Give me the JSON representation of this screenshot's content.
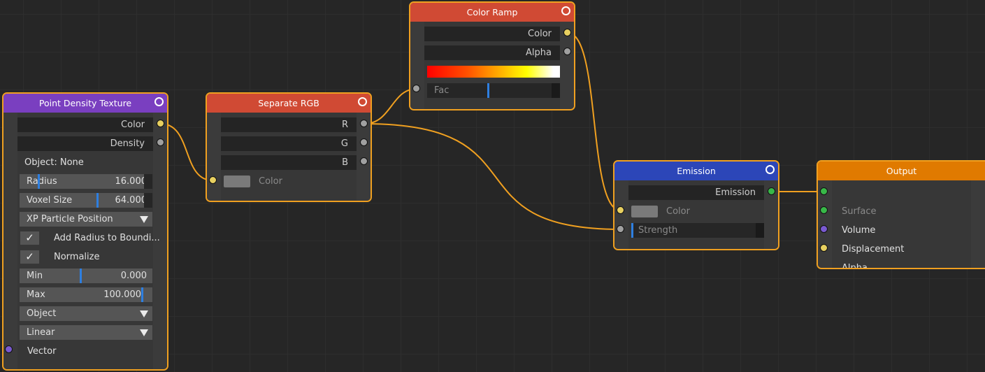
{
  "nodes": {
    "point_density": {
      "title": "Point Density Texture",
      "outputs": [
        "Color",
        "Density"
      ],
      "object_label": "Object: None",
      "radius": {
        "label": "Radius",
        "value": "16.000"
      },
      "voxel": {
        "label": "Voxel Size",
        "value": "64.000"
      },
      "source_dropdown": "XP Particle Position",
      "add_radius": {
        "label": "Add Radius to Boundi...",
        "checked": true
      },
      "normalize": {
        "label": "Normalize",
        "checked": true
      },
      "min": {
        "label": "Min",
        "value": "0.000"
      },
      "max": {
        "label": "Max",
        "value": "100.000"
      },
      "space_dropdown": "Object",
      "interp_dropdown": "Linear",
      "vector_input": "Vector",
      "header_color": "#7a3fc0"
    },
    "separate_rgb": {
      "title": "Separate RGB",
      "outputs": [
        "R",
        "G",
        "B"
      ],
      "input": "Color",
      "header_color": "#d04a34"
    },
    "color_ramp": {
      "title": "Color Ramp",
      "outputs": [
        "Color",
        "Alpha"
      ],
      "input": "Fac",
      "header_color": "#d04a34"
    },
    "emission": {
      "title": "Emission",
      "output": "Emission",
      "inputs": [
        "Color",
        "Strength"
      ],
      "header_color": "#2c46b8"
    },
    "output": {
      "title": "Output",
      "inputs": [
        "Surface",
        "Volume",
        "Displacement",
        "Alpha"
      ],
      "header_color": "#e07a00"
    }
  }
}
